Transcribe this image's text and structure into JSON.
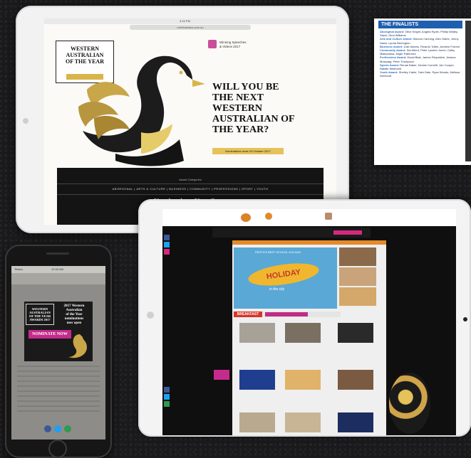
{
  "tablet_top": {
    "status_time": "3:15 PM",
    "url": "celebrateaus.com.au",
    "logo_line1": "WESTERN",
    "logo_line2": "AUSTRALIAN",
    "logo_line3": "OF THE YEAR",
    "promo_line1": "Winning Speeches",
    "promo_line2": "& Videos 2017",
    "headline_1": "WILL YOU BE",
    "headline_2": "THE NEXT",
    "headline_3": "WESTERN",
    "headline_4": "AUSTRALIAN OF",
    "headline_5": "THE YEAR?",
    "cta": "Nominations close 29 October 2017",
    "award_categories_label": "Award Categories",
    "categories": "ABORIGINAL | ARTS & CULTURE | BUSINESS | COMMUNITY | PROFESSIONS | SPORT | YOUTH",
    "nominations_open": "Nominations Now Open"
  },
  "finalists": {
    "title": "THE FINALISTS",
    "entries": [
      {
        "award": "Aboriginal Award:",
        "names": "Olive Knight, Angela Ryder, Phillip Walley-Stack, Gina Williams"
      },
      {
        "award": "Arts and Culture Award:",
        "names": "Marcus Canning, Alex Gates, Jenny Davis, Lynda Berrington"
      },
      {
        "award": "Business Award:",
        "names": "Julie Adams, Ricardo Tullier, Andrew Forrest"
      },
      {
        "award": "Community Award:",
        "names": "Dia Alford, Peter Lynden Jones, Cathy Matsuzawa, Angie Pallerona"
      },
      {
        "award": "Professions Award:",
        "names": "David Blair, James Fitzpatrick, Jessica Mossaag, Peter Thompson"
      },
      {
        "award": "Sports Award:",
        "names": "Renae Baker, Dennis Cometti, Jan Cooper, Natalie Medhurst"
      },
      {
        "award": "Youth Award:",
        "names": "Shelley Cable, Tash Dale, Ryan Woods, Melissa Northcott"
      }
    ]
  },
  "phone": {
    "status_carrier": "Telstra",
    "status_time": "10:30 AM",
    "logo_line1": "WESTERN",
    "logo_line2": "AUSTRALIAN",
    "logo_line3": "OF THE YEAR",
    "logo_line4": "AWARDS 2017",
    "promo_1": "2017 Western",
    "promo_2": "Australian",
    "promo_3": "of the Year",
    "promo_4": "nominations",
    "promo_5": "now open",
    "button": "NOMINATE NOW"
  },
  "tablet_bottom": {
    "holiday_title": "HOLIDAY",
    "holiday_sub": "in the city",
    "holiday_top": "PERTH'S BEST SCHOOL HOLIDAY",
    "ad_label": "BREAKFAST"
  }
}
